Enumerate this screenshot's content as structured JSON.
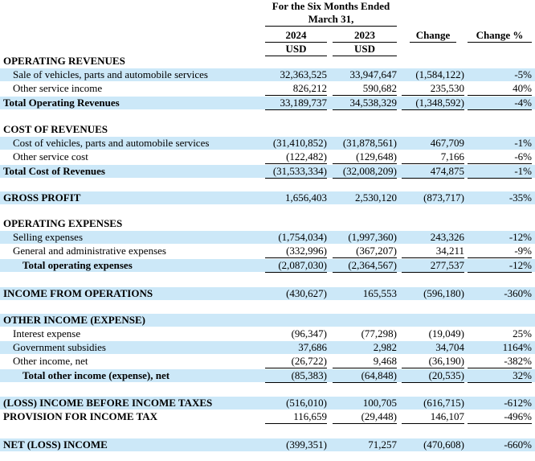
{
  "header": {
    "period_line1": "For the Six Months Ended",
    "period_line2": "March 31,",
    "col_2024": "2024",
    "col_2023": "2023",
    "unit_2024": "USD",
    "unit_2023": "USD",
    "col_change": "Change",
    "col_change_pct": "Change %"
  },
  "rows": [
    {
      "label": "OPERATING REVENUES",
      "v1": "",
      "v2": "",
      "v3": "",
      "v4": ""
    },
    {
      "label": "Sale of vehicles, parts and automobile services",
      "v1": "32,363,525",
      "v2": "33,947,647",
      "v3": "(1,584,122)",
      "v4": "-5%"
    },
    {
      "label": "Other service income",
      "v1": "826,212",
      "v2": "590,682",
      "v3": "235,530",
      "v4": "40%"
    },
    {
      "label": "Total Operating Revenues",
      "v1": "33,189,737",
      "v2": "34,538,329",
      "v3": "(1,348,592)",
      "v4": "-4%"
    },
    {
      "label": "COST OF REVENUES",
      "v1": "",
      "v2": "",
      "v3": "",
      "v4": ""
    },
    {
      "label": "Cost of vehicles, parts and automobile services",
      "v1": "(31,410,852)",
      "v2": "(31,878,561)",
      "v3": "467,709",
      "v4": "-1%"
    },
    {
      "label": "Other service cost",
      "v1": "(122,482)",
      "v2": "(129,648)",
      "v3": "7,166",
      "v4": "-6%"
    },
    {
      "label": "Total Cost of Revenues",
      "v1": "(31,533,334)",
      "v2": "(32,008,209)",
      "v3": "474,875",
      "v4": "-1%"
    },
    {
      "label": "GROSS PROFIT",
      "v1": "1,656,403",
      "v2": "2,530,120",
      "v3": "(873,717)",
      "v4": "-35%"
    },
    {
      "label": "OPERATING EXPENSES",
      "v1": "",
      "v2": "",
      "v3": "",
      "v4": ""
    },
    {
      "label": "Selling expenses",
      "v1": "(1,754,034)",
      "v2": "(1,997,360)",
      "v3": "243,326",
      "v4": "-12%"
    },
    {
      "label": "General and administrative expenses",
      "v1": "(332,996)",
      "v2": "(367,207)",
      "v3": "34,211",
      "v4": "-9%"
    },
    {
      "label": "Total operating expenses",
      "v1": "(2,087,030)",
      "v2": "(2,364,567)",
      "v3": "277,537",
      "v4": "-12%"
    },
    {
      "label": "INCOME FROM OPERATIONS",
      "v1": "(430,627)",
      "v2": "165,553",
      "v3": "(596,180)",
      "v4": "-360%"
    },
    {
      "label": "OTHER INCOME (EXPENSE)",
      "v1": "",
      "v2": "",
      "v3": "",
      "v4": ""
    },
    {
      "label": "Interest expense",
      "v1": "(96,347)",
      "v2": "(77,298)",
      "v3": "(19,049)",
      "v4": "25%"
    },
    {
      "label": "Government subsidies",
      "v1": "37,686",
      "v2": "2,982",
      "v3": "34,704",
      "v4": "1164%"
    },
    {
      "label": "Other income, net",
      "v1": "(26,722)",
      "v2": "9,468",
      "v3": "(36,190)",
      "v4": "-382%"
    },
    {
      "label": "Total other income (expense), net",
      "v1": "(85,383)",
      "v2": "(64,848)",
      "v3": "(20,535)",
      "v4": "32%"
    },
    {
      "label": "(LOSS) INCOME BEFORE INCOME TAXES",
      "v1": "(516,010)",
      "v2": "100,705",
      "v3": "(616,715)",
      "v4": "-612%"
    },
    {
      "label": "PROVISION FOR INCOME TAX",
      "v1": "116,659",
      "v2": "(29,448)",
      "v3": "146,107",
      "v4": "-496%"
    },
    {
      "label": "NET (LOSS) INCOME",
      "v1": "(399,351)",
      "v2": "71,257",
      "v3": "(470,608)",
      "v4": "-660%"
    }
  ]
}
